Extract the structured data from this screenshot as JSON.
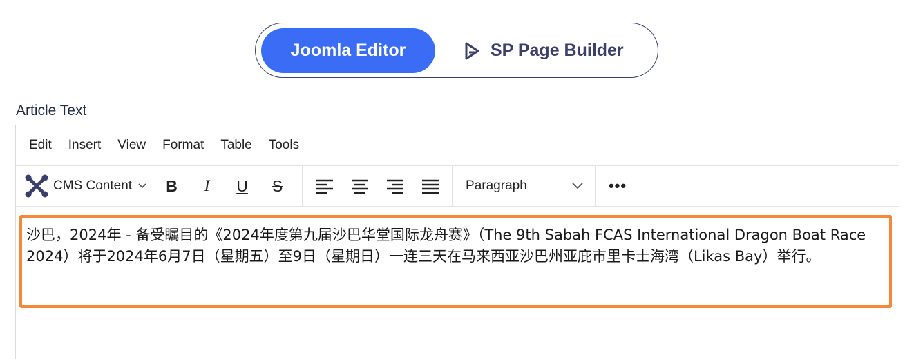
{
  "toggle": {
    "active_label": "Joomla Editor",
    "other_label": "SP Page Builder"
  },
  "field_label": "Article Text",
  "menubar": [
    "Edit",
    "Insert",
    "View",
    "Format",
    "Table",
    "Tools"
  ],
  "toolbar": {
    "cms_label": "CMS Content",
    "bold": "B",
    "italic": "I",
    "underline": "U",
    "strike": "S",
    "block_format": "Paragraph",
    "more": "•••"
  },
  "content": {
    "text": "沙巴，2024年 - 备受瞩目的《2024年度第九届沙巴华堂国际龙舟赛》（The 9th Sabah FCAS International Dragon Boat Race 2024）将于2024年6月7日（星期五）至9日（星期日）一连三天在马来西亚沙巴州亚庇市里卡士海湾（Likas Bay）举行。"
  },
  "colors": {
    "accent": "#3b6cf6",
    "highlight_border": "#f5883a"
  }
}
